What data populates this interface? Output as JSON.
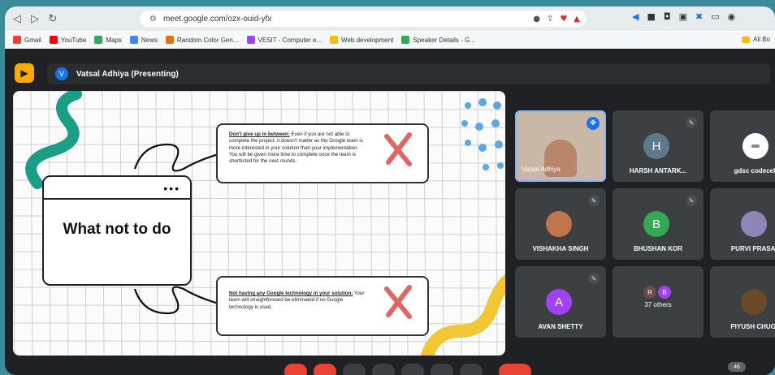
{
  "browser": {
    "url": "meet.google.com/ozx-ouid-yfx",
    "nav": {
      "back": "◁",
      "forward": "▷",
      "reload": "↻",
      "tab": "▢"
    },
    "bookmarks": [
      {
        "label": "Gmail",
        "color": "#ea4335"
      },
      {
        "label": "YouTube",
        "color": "#ff0000"
      },
      {
        "label": "Maps",
        "color": "#34a853"
      },
      {
        "label": "News",
        "color": "#4285f4"
      },
      {
        "label": "Random Color Gen...",
        "color": "#e8710a"
      },
      {
        "label": "VESIT - Computer e...",
        "color": "#a142f4"
      },
      {
        "label": "Web development",
        "color": "#fbbc04"
      },
      {
        "label": "Speaker Details - G...",
        "color": "#34a853"
      }
    ],
    "all_bookmarks": "All Bo"
  },
  "meet": {
    "presenter_initial": "V",
    "presenter_label": "Vatsal Adhiya (Presenting)",
    "accent": "#f9ab00"
  },
  "slide": {
    "title": "What not to do",
    "dots": "•••",
    "tips": [
      {
        "heading": "Don't give up in between:",
        "body": " Even if you are not able to complete the project, it doesn't matter as the Google team is more interested in your solution than your implementation. You will be given more time to complete once the team is shortlisted for the next rounds."
      },
      {
        "heading": "Not having any Google technology in your solution:",
        "body": " Your team will straightforward be eliminated if no Google technology is used."
      }
    ]
  },
  "participants": [
    {
      "name": "Vatsal Adhiya",
      "initial": "",
      "color": "#b9856a",
      "kind": "video"
    },
    {
      "name": "HARSH ANTARK...",
      "initial": "H",
      "color": "#5f7a8a",
      "kind": "avatar"
    },
    {
      "name": "gdsc codecell",
      "initial": "",
      "color": "#ffffff",
      "kind": "logo"
    },
    {
      "name": "VISHAKHA SINGH",
      "initial": "",
      "color": "#c0764a",
      "kind": "photo"
    },
    {
      "name": "BHUSHAN KOR",
      "initial": "B",
      "color": "#34a853",
      "kind": "avatar"
    },
    {
      "name": "PURVI PRASAD",
      "initial": "",
      "color": "#8f86b8",
      "kind": "photo"
    },
    {
      "name": "AVAN SHETTY",
      "initial": "A",
      "color": "#a142f4",
      "kind": "avatar"
    },
    {
      "name": "37 others",
      "initial": "",
      "color": "#3c4043",
      "kind": "others"
    },
    {
      "name": "PIYUSH CHUGH",
      "initial": "",
      "color": "#6b4a2a",
      "kind": "photo"
    }
  ],
  "others_avatars": [
    "R",
    "B"
  ],
  "badge": "46"
}
